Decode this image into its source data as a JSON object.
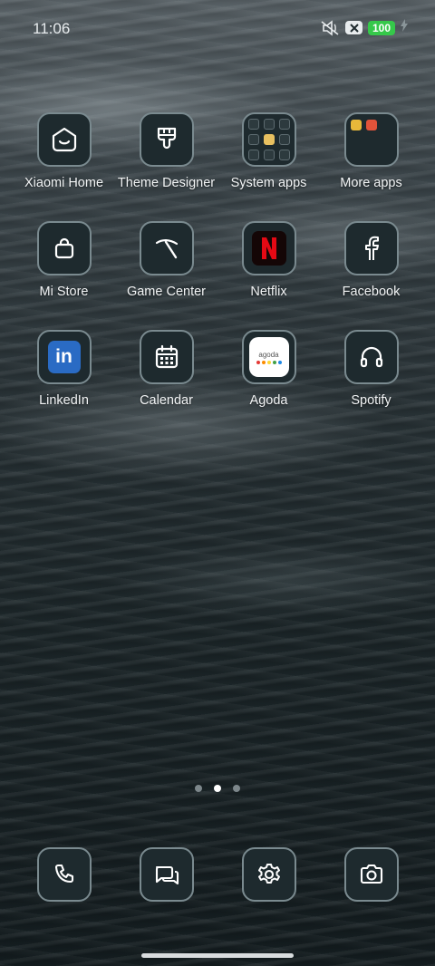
{
  "status_bar": {
    "time": "11:06",
    "battery_level": "100",
    "icons": [
      "mute-icon",
      "notification-x-icon",
      "battery-icon",
      "charging-icon"
    ]
  },
  "apps": [
    {
      "id": "xiaomi-home",
      "label": "Xiaomi Home",
      "icon": "xiaomi-home-icon"
    },
    {
      "id": "theme-designer",
      "label": "Theme Designer",
      "icon": "paintbrush-icon"
    },
    {
      "id": "system-apps",
      "label": "System apps",
      "icon": "folder-icon"
    },
    {
      "id": "more-apps",
      "label": "More apps",
      "icon": "folder-icon"
    },
    {
      "id": "mi-store",
      "label": "Mi Store",
      "icon": "shopping-bag-icon"
    },
    {
      "id": "game-center",
      "label": "Game Center",
      "icon": "pickaxe-icon"
    },
    {
      "id": "netflix",
      "label": "Netflix",
      "icon": "netflix-logo-icon",
      "brand_color": "#e50914"
    },
    {
      "id": "facebook",
      "label": "Facebook",
      "icon": "facebook-f-icon"
    },
    {
      "id": "linkedin",
      "label": "LinkedIn",
      "icon": "linkedin-logo-icon",
      "brand_color": "#2a6bc4",
      "logo_text": "in"
    },
    {
      "id": "calendar",
      "label": "Calendar",
      "icon": "calendar-icon"
    },
    {
      "id": "agoda",
      "label": "Agoda",
      "icon": "agoda-logo-icon",
      "logo_text": "agoda"
    },
    {
      "id": "spotify",
      "label": "Spotify",
      "icon": "headphones-icon"
    }
  ],
  "page_indicator": {
    "pages": 3,
    "current": 2
  },
  "dock": [
    {
      "id": "phone",
      "icon": "phone-icon"
    },
    {
      "id": "messages",
      "icon": "chat-bubbles-icon"
    },
    {
      "id": "settings",
      "icon": "gear-icon"
    },
    {
      "id": "camera",
      "icon": "camera-icon"
    }
  ],
  "colors": {
    "tile_background": "#1e2a2e",
    "tile_border": "#7a8a8f",
    "battery_green": "#35c84a"
  }
}
